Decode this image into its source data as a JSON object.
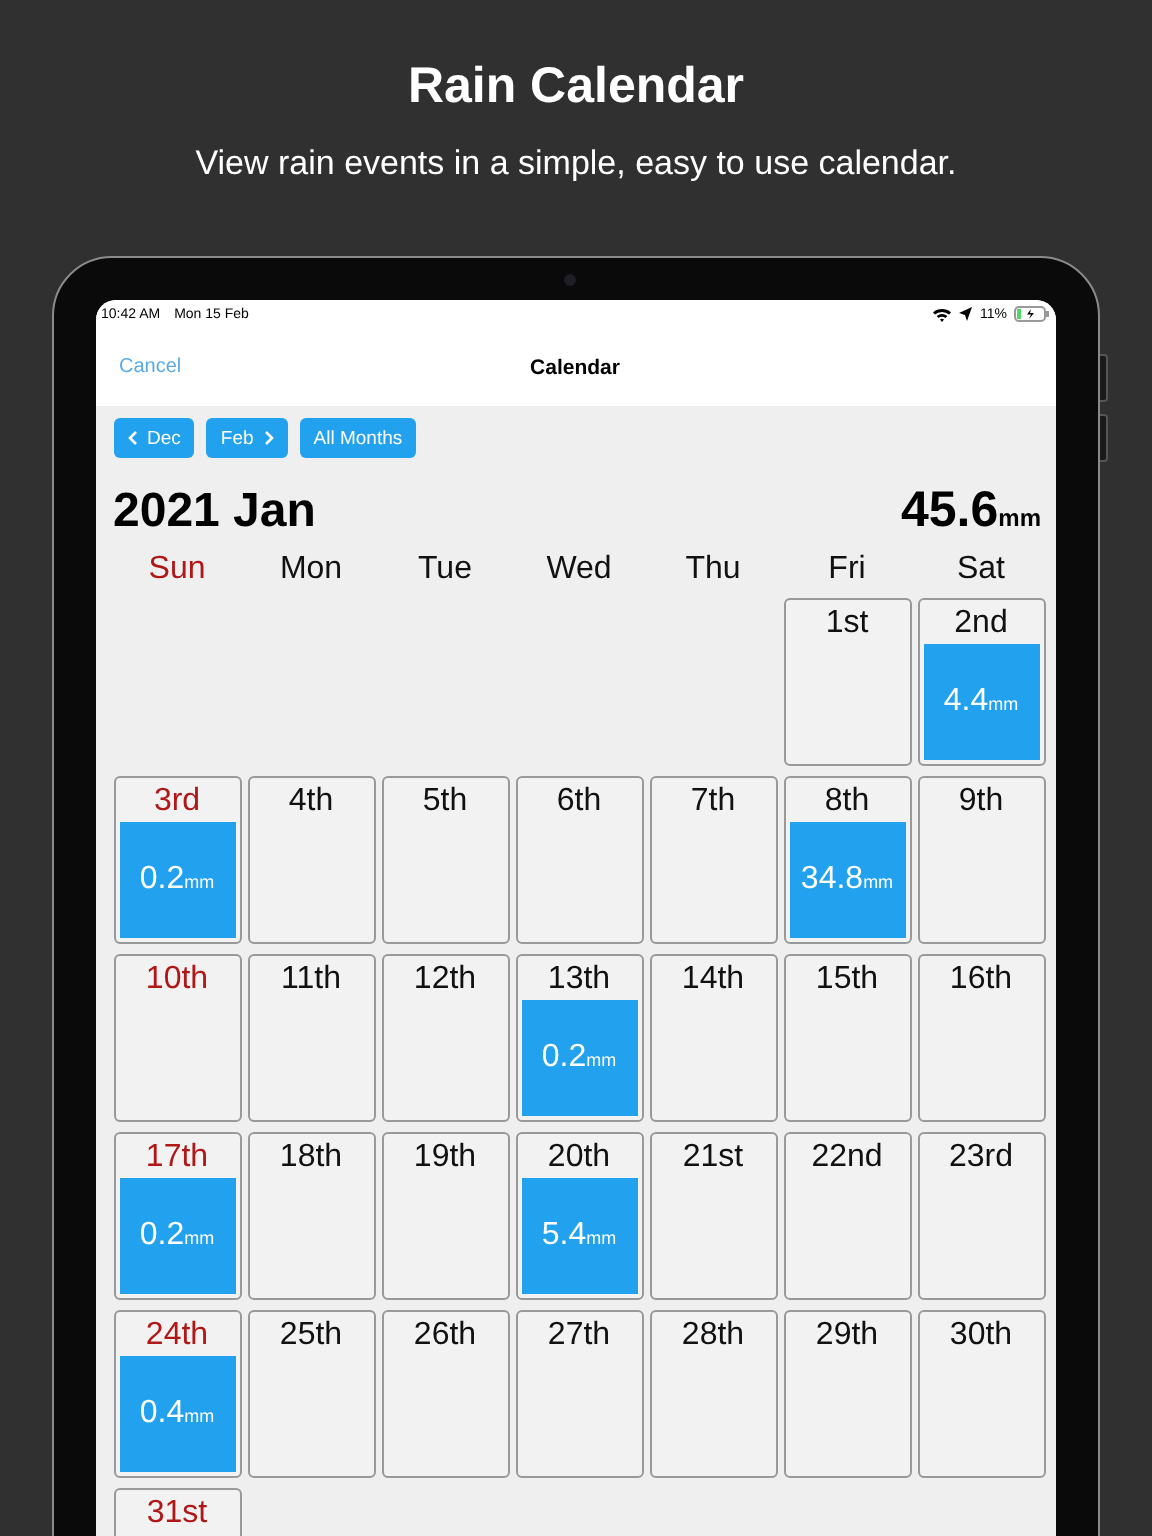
{
  "promo": {
    "title": "Rain Calendar",
    "subtitle": "View rain events in a simple, easy to use calendar."
  },
  "status_bar": {
    "time": "10:42 AM",
    "date": "Mon 15 Feb",
    "battery": "11%"
  },
  "nav_bar": {
    "cancel": "Cancel",
    "title": "Calendar"
  },
  "month_buttons": [
    {
      "label": "Dec",
      "kind": "prev"
    },
    {
      "label": "Feb",
      "kind": "next"
    },
    {
      "label": "All Months",
      "kind": "plain"
    }
  ],
  "month_title": "2021 Jan",
  "total": {
    "value": "45.6",
    "unit": "mm"
  },
  "weekdays": [
    {
      "label": "Sun",
      "sunday": true
    },
    {
      "label": "Mon",
      "sunday": false
    },
    {
      "label": "Tue",
      "sunday": false
    },
    {
      "label": "Wed",
      "sunday": false
    },
    {
      "label": "Thu",
      "sunday": false
    },
    {
      "label": "Fri",
      "sunday": false
    },
    {
      "label": "Sat",
      "sunday": false
    }
  ],
  "weeks": [
    [
      {
        "kind": "empty"
      },
      {
        "kind": "empty"
      },
      {
        "kind": "empty"
      },
      {
        "kind": "empty"
      },
      {
        "kind": "empty"
      },
      {
        "kind": "day",
        "label": "1st",
        "sunday": false
      },
      {
        "kind": "day",
        "label": "2nd",
        "sunday": false,
        "rain": {
          "value": "4.4",
          "unit": "mm"
        }
      }
    ],
    [
      {
        "kind": "day",
        "label": "3rd",
        "sunday": true,
        "rain": {
          "value": "0.2",
          "unit": "mm"
        }
      },
      {
        "kind": "day",
        "label": "4th",
        "sunday": false
      },
      {
        "kind": "day",
        "label": "5th",
        "sunday": false
      },
      {
        "kind": "day",
        "label": "6th",
        "sunday": false
      },
      {
        "kind": "day",
        "label": "7th",
        "sunday": false
      },
      {
        "kind": "day",
        "label": "8th",
        "sunday": false,
        "rain": {
          "value": "34.8",
          "unit": "mm"
        }
      },
      {
        "kind": "day",
        "label": "9th",
        "sunday": false
      }
    ],
    [
      {
        "kind": "day",
        "label": "10th",
        "sunday": true
      },
      {
        "kind": "day",
        "label": "11th",
        "sunday": false
      },
      {
        "kind": "day",
        "label": "12th",
        "sunday": false
      },
      {
        "kind": "day",
        "label": "13th",
        "sunday": false,
        "rain": {
          "value": "0.2",
          "unit": "mm"
        }
      },
      {
        "kind": "day",
        "label": "14th",
        "sunday": false
      },
      {
        "kind": "day",
        "label": "15th",
        "sunday": false
      },
      {
        "kind": "day",
        "label": "16th",
        "sunday": false
      }
    ],
    [
      {
        "kind": "day",
        "label": "17th",
        "sunday": true,
        "rain": {
          "value": "0.2",
          "unit": "mm"
        }
      },
      {
        "kind": "day",
        "label": "18th",
        "sunday": false
      },
      {
        "kind": "day",
        "label": "19th",
        "sunday": false
      },
      {
        "kind": "day",
        "label": "20th",
        "sunday": false,
        "rain": {
          "value": "5.4",
          "unit": "mm"
        }
      },
      {
        "kind": "day",
        "label": "21st",
        "sunday": false
      },
      {
        "kind": "day",
        "label": "22nd",
        "sunday": false
      },
      {
        "kind": "day",
        "label": "23rd",
        "sunday": false
      }
    ],
    [
      {
        "kind": "day",
        "label": "24th",
        "sunday": true,
        "rain": {
          "value": "0.4",
          "unit": "mm"
        }
      },
      {
        "kind": "day",
        "label": "25th",
        "sunday": false
      },
      {
        "kind": "day",
        "label": "26th",
        "sunday": false
      },
      {
        "kind": "day",
        "label": "27th",
        "sunday": false
      },
      {
        "kind": "day",
        "label": "28th",
        "sunday": false
      },
      {
        "kind": "day",
        "label": "29th",
        "sunday": false
      },
      {
        "kind": "day",
        "label": "30th",
        "sunday": false
      }
    ],
    [
      {
        "kind": "day",
        "label": "31st",
        "sunday": true
      }
    ]
  ]
}
